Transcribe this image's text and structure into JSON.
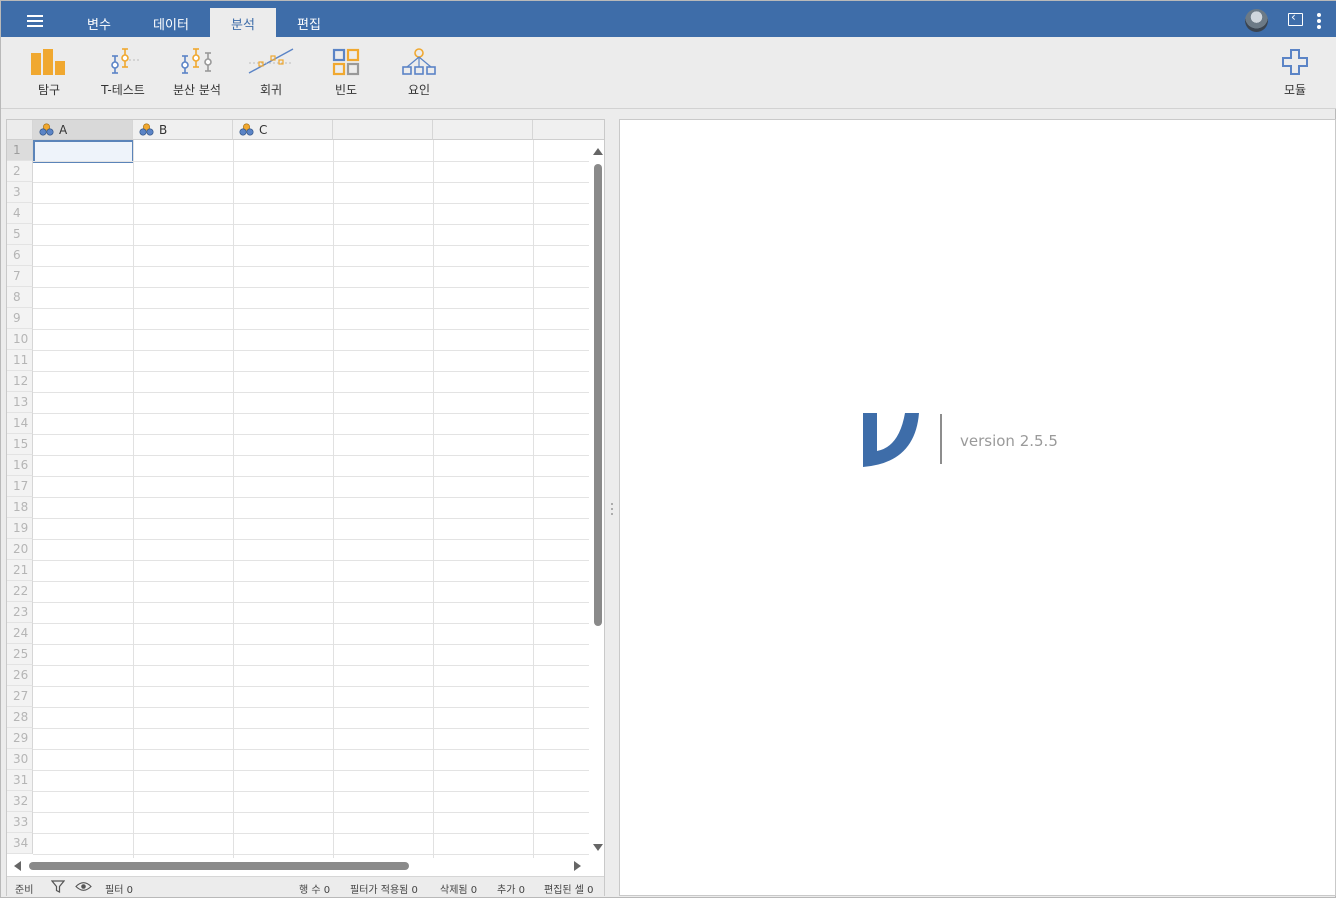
{
  "topbar": {
    "tabs": [
      "변수",
      "데이터",
      "분석",
      "편집"
    ],
    "active_tab": "분석"
  },
  "ribbon": {
    "buttons": [
      {
        "label": "탐구",
        "icon": "bar-chart-icon"
      },
      {
        "label": "T-테스트",
        "icon": "t-test-icon"
      },
      {
        "label": "분산 분석",
        "icon": "anova-icon"
      },
      {
        "label": "회귀",
        "icon": "regression-icon"
      },
      {
        "label": "빈도",
        "icon": "frequencies-icon"
      },
      {
        "label": "요인",
        "icon": "factor-icon"
      }
    ],
    "modules_label": "모듈"
  },
  "spreadsheet": {
    "columns": [
      "A",
      "B",
      "C"
    ],
    "rows": [
      "1",
      "2",
      "3",
      "4",
      "5",
      "6",
      "7",
      "8",
      "9",
      "10",
      "11",
      "12",
      "13",
      "14",
      "15",
      "16",
      "17",
      "18",
      "19",
      "20",
      "21",
      "22",
      "23",
      "24",
      "25",
      "26",
      "27",
      "28",
      "29",
      "30",
      "31",
      "32",
      "33",
      "34"
    ]
  },
  "status": {
    "ready": "준비",
    "filter": "필터 0",
    "row_count": "행 수 0",
    "filtered": "필터가 적용됨 0",
    "deleted": "삭제됨 0",
    "added": "추가 0",
    "edited": "편집된 셀 0"
  },
  "results": {
    "version": "version 2.5.5"
  },
  "colors": {
    "brand_blue": "#3e6da9",
    "icon_orange": "#f0a830",
    "icon_blue": "#5b84c6"
  }
}
